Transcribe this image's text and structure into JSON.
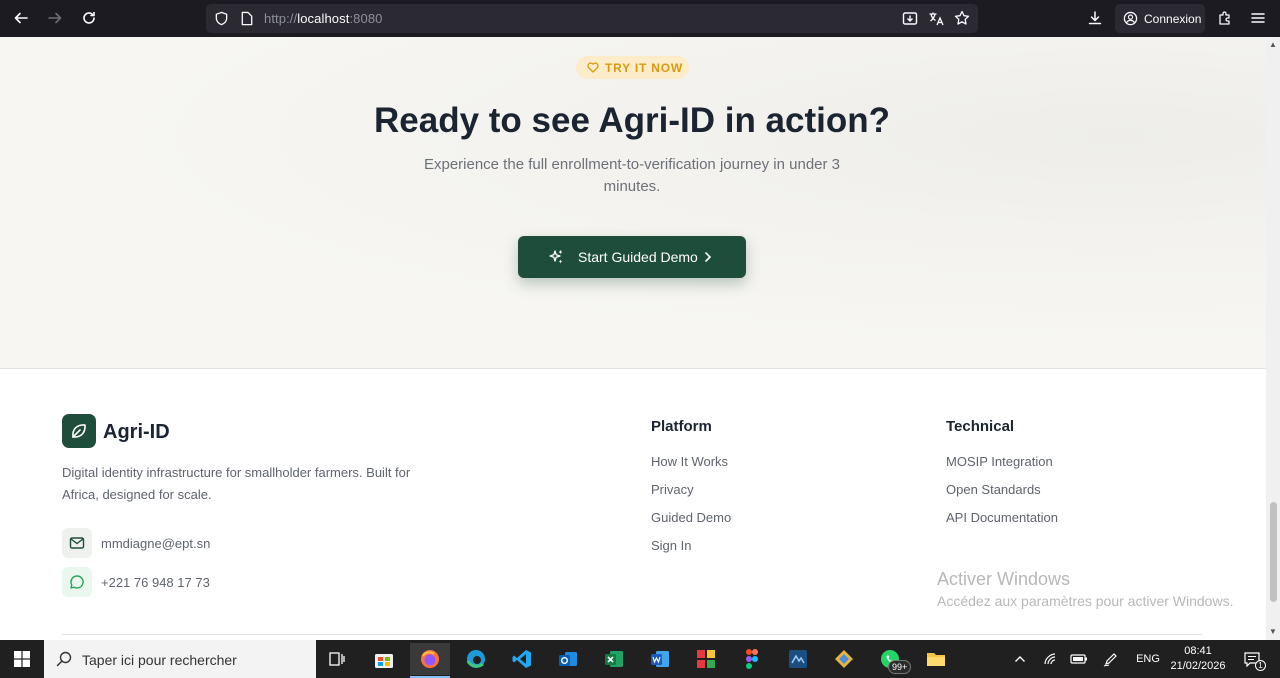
{
  "browser": {
    "url_scheme": "http://",
    "url_host": "localhost",
    "url_port": ":8080",
    "account_label": "Connexion"
  },
  "hero": {
    "badge": "TRY IT NOW",
    "title": "Ready to see Agri-ID in action?",
    "subtitle": "Experience the full enrollment-to-verification journey in under 3 minutes.",
    "cta_label": "Start Guided Demo"
  },
  "footer": {
    "brand": "Agri-ID",
    "tagline": "Digital identity infrastructure for smallholder farmers. Built for Africa, designed for scale.",
    "email": "mmdiagne@ept.sn",
    "phone": "+221 76 948 17 73",
    "platform": {
      "title": "Platform",
      "links": [
        "How It Works",
        "Privacy",
        "Guided Demo",
        "Sign In"
      ]
    },
    "technical": {
      "title": "Technical",
      "links": [
        "MOSIP Integration",
        "Open Standards",
        "API Documentation"
      ]
    }
  },
  "watermark": {
    "title": "Activer Windows",
    "subtitle": "Accédez aux paramètres pour activer Windows."
  },
  "taskbar": {
    "search_placeholder": "Taper ici pour rechercher",
    "whatsapp_badge": "99+",
    "language": "ENG",
    "time": "08:41",
    "date": "21/02/2026",
    "notification_count": "1"
  },
  "colors": {
    "brand_green": "#1f4d3b",
    "badge_bg": "#fcecc9",
    "badge_text": "#d99a12",
    "page_bg": "#f7f6f2"
  }
}
